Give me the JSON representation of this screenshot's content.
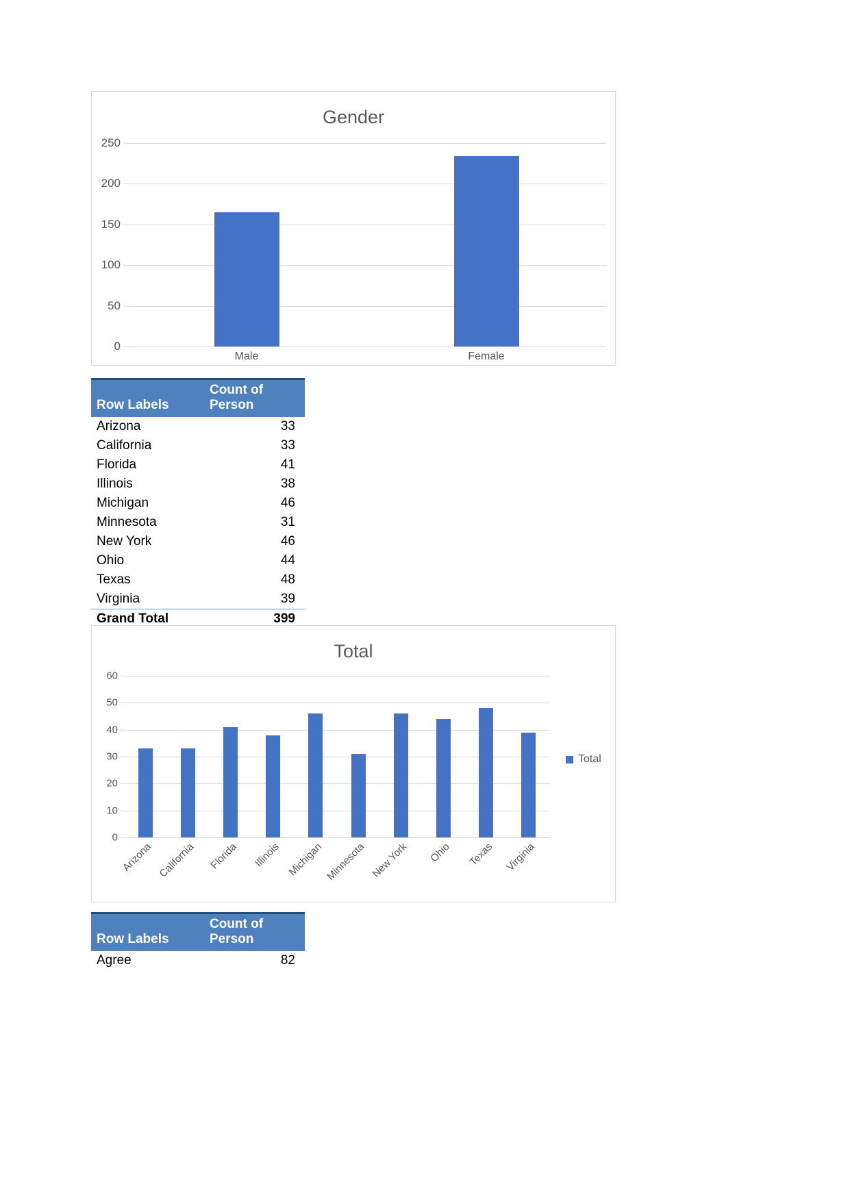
{
  "chart_data": [
    {
      "id": "gender-chart",
      "type": "bar",
      "title": "Gender",
      "categories": [
        "Male",
        "Female"
      ],
      "values": [
        165,
        234
      ],
      "series_name": "Gender",
      "xlabel": "",
      "ylabel": "",
      "ylim": [
        0,
        250
      ],
      "yticks": [
        0,
        50,
        100,
        150,
        200,
        250
      ],
      "grid": true,
      "legend": false,
      "legend_position": "none",
      "bar_color": "#4472C4"
    },
    {
      "id": "total-chart",
      "type": "bar",
      "title": "Total",
      "categories": [
        "Arizona",
        "California",
        "Florida",
        "Illinois",
        "Michigan",
        "Minnesota",
        "New York",
        "Ohio",
        "Texas",
        "Virginia"
      ],
      "values": [
        33,
        33,
        41,
        38,
        46,
        31,
        46,
        44,
        48,
        39
      ],
      "series": [
        {
          "name": "Total",
          "values": [
            33,
            33,
            41,
            38,
            46,
            31,
            46,
            44,
            48,
            39
          ]
        }
      ],
      "xlabel": "",
      "ylabel": "",
      "ylim": [
        0,
        60
      ],
      "yticks": [
        0,
        10,
        20,
        30,
        40,
        50,
        60
      ],
      "grid": true,
      "legend": true,
      "legend_entries": [
        "Total"
      ],
      "legend_position": "right",
      "bar_color": "#4472C4"
    }
  ],
  "state_table": {
    "headers": {
      "row_labels": "Row Labels",
      "count_of_person": "Count of Person"
    },
    "rows": [
      {
        "label": "Arizona",
        "value": "33"
      },
      {
        "label": "California",
        "value": "33"
      },
      {
        "label": "Florida",
        "value": "41"
      },
      {
        "label": "Illinois",
        "value": "38"
      },
      {
        "label": "Michigan",
        "value": "46"
      },
      {
        "label": "Minnesota",
        "value": "31"
      },
      {
        "label": "New York",
        "value": "46"
      },
      {
        "label": "Ohio",
        "value": "44"
      },
      {
        "label": "Texas",
        "value": "48"
      },
      {
        "label": "Virginia",
        "value": "39"
      }
    ],
    "grand_total": {
      "label": "Grand Total",
      "value": "399"
    }
  },
  "agreement_table": {
    "headers": {
      "row_labels": "Row Labels",
      "count_of_person": "Count of Person"
    },
    "rows": [
      {
        "label": "Agree",
        "value": "82"
      }
    ]
  },
  "colors": {
    "bar": "#4472C4",
    "table_header": "#4E81BD",
    "table_rule": "#1F4E79",
    "chart_title": "#595959",
    "gridline": "#D9D9D9",
    "panel_border": "#D9D9D9"
  }
}
